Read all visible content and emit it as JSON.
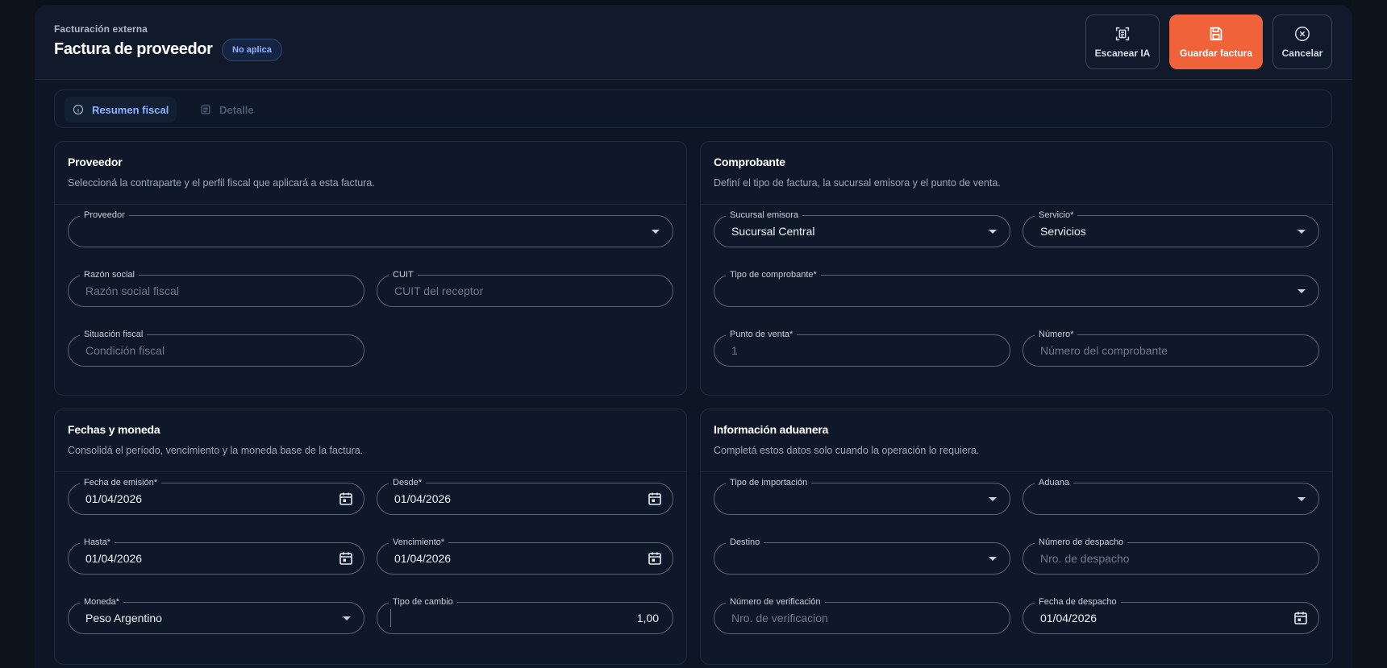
{
  "header": {
    "eyebrow": "Facturación externa",
    "title": "Factura de proveedor",
    "badge": "No aplica",
    "buttons": {
      "scan": "Escanear IA",
      "save": "Guardar factura",
      "cancel": "Cancelar"
    },
    "save_color": "#f0623a"
  },
  "tabs": [
    {
      "label": "Resumen fiscal",
      "icon": "info-icon",
      "active": true
    },
    {
      "label": "Detalle",
      "icon": "list-icon",
      "active": false
    }
  ],
  "proveedor": {
    "title": "Proveedor",
    "subtitle": "Seleccioná la contraparte y el perfil fiscal que aplicará a esta factura.",
    "fields": {
      "proveedor": {
        "label": "Proveedor",
        "value": ""
      },
      "razon_social": {
        "label": "Razón social",
        "placeholder": "Razón social fiscal"
      },
      "cuit": {
        "label": "CUIT",
        "placeholder": "CUIT del receptor"
      },
      "situacion": {
        "label": "Situación fiscal",
        "placeholder": "Condición fiscal"
      }
    }
  },
  "comprobante": {
    "title": "Comprobante",
    "subtitle": "Definí el tipo de factura, la sucursal emisora y el punto de venta.",
    "fields": {
      "sucursal": {
        "label": "Sucursal emisora",
        "value": "Sucursal Central"
      },
      "servicio": {
        "label": "Servicio*",
        "value": "Servicios"
      },
      "tipo": {
        "label": "Tipo de comprobante*",
        "value": ""
      },
      "punto": {
        "label": "Punto de venta*",
        "placeholder": "1"
      },
      "numero": {
        "label": "Número*",
        "placeholder": "Número del comprobante"
      }
    }
  },
  "fechas": {
    "title": "Fechas y moneda",
    "subtitle": "Consolidá el período, vencimiento y la moneda base de la factura.",
    "fields": {
      "emision": {
        "label": "Fecha de emisión*",
        "value": "01/04/2026"
      },
      "desde": {
        "label": "Desde*",
        "value": "01/04/2026"
      },
      "hasta": {
        "label": "Hasta*",
        "value": "01/04/2026"
      },
      "vencimiento": {
        "label": "Vencimiento*",
        "value": "01/04/2026"
      },
      "moneda": {
        "label": "Moneda*",
        "value": "Peso Argentino"
      },
      "tipo_cambio": {
        "label": "Tipo de cambio",
        "value": "1,00"
      }
    }
  },
  "aduana": {
    "title": "Información aduanera",
    "subtitle": "Completá estos datos solo cuando la operación lo requiera.",
    "fields": {
      "tipo_importacion": {
        "label": "Tipo de importación",
        "value": ""
      },
      "aduana": {
        "label": "Aduana",
        "value": ""
      },
      "destino": {
        "label": "Destino",
        "value": ""
      },
      "despacho": {
        "label": "Número de despacho",
        "placeholder": "Nro. de despacho"
      },
      "verificacion": {
        "label": "Número de verificación",
        "placeholder": "Nro. de verificacion"
      },
      "fecha_despacho": {
        "label": "Fecha de despacho",
        "value": "01/04/2026"
      }
    }
  }
}
